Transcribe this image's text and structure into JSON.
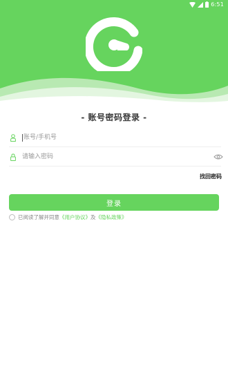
{
  "status_bar": {
    "time": "6:51",
    "icons": [
      "wifi-icon",
      "signal-icon",
      "battery-icon"
    ]
  },
  "colors": {
    "brand_green": "#66d45e",
    "text_dark": "#3a3a3a",
    "placeholder": "#999999"
  },
  "login": {
    "title": "- 账号密码登录 -",
    "username_placeholder": "账号/手机号",
    "password_placeholder": "请输入密码",
    "forgot_label": "找回密码",
    "submit_label": "登录"
  },
  "agreement": {
    "prefix": "已阅读了解并同意",
    "user_agreement": "《用户协议》",
    "joiner": "及",
    "privacy_policy": "《隐私政策》"
  }
}
